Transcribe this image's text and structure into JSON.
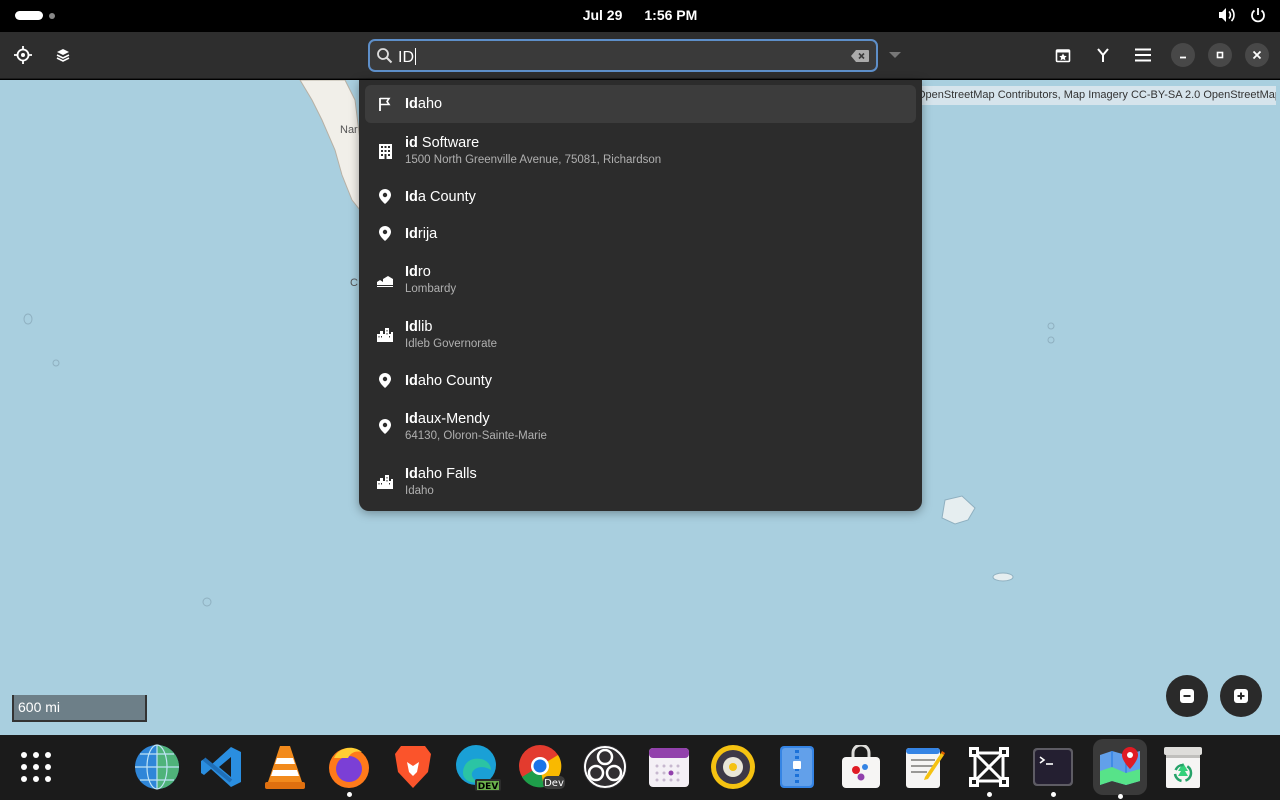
{
  "topbar": {
    "date": "Jul 29",
    "time": "1:56 PM"
  },
  "search": {
    "value": "ID"
  },
  "map": {
    "attribution": "OpenStreetMap Contributors, Map Imagery CC-BY-SA 2.0 OpenStreetMap",
    "scale_label": "600 mi",
    "place_fragments": [
      "Nar",
      "C"
    ]
  },
  "results": [
    {
      "bold": "Id",
      "rest": "aho",
      "sub": "",
      "icon": "flag-icon"
    },
    {
      "bold": "id",
      "rest": " Software",
      "sub": "1500 North Greenville Avenue, 75081, Richardson",
      "icon": "building-icon"
    },
    {
      "bold": "Id",
      "rest": "a County",
      "sub": "",
      "icon": "pin-icon"
    },
    {
      "bold": "Id",
      "rest": "rija",
      "sub": "",
      "icon": "pin-icon"
    },
    {
      "bold": "Id",
      "rest": "ro",
      "sub": "Lombardy",
      "icon": "town-icon"
    },
    {
      "bold": "Id",
      "rest": "lib",
      "sub": "Idleb Governorate",
      "icon": "city-icon"
    },
    {
      "bold": "Id",
      "rest": "aho County",
      "sub": "",
      "icon": "pin-icon"
    },
    {
      "bold": "Id",
      "rest": "aux-Mendy",
      "sub": "64130, Oloron-Sainte-Marie",
      "icon": "pin-icon"
    },
    {
      "bold": "Id",
      "rest": "aho Falls",
      "sub": "Idaho",
      "icon": "city-icon"
    }
  ],
  "dock": {
    "apps": [
      "app-grid",
      "globe",
      "vscode",
      "vlc",
      "firefox",
      "brave",
      "edge-dev",
      "chrome-dev",
      "obs",
      "calendar",
      "rhythmbox",
      "file-roller",
      "software",
      "text-editor",
      "boxes",
      "terminal",
      "maps",
      "trash"
    ]
  },
  "colors": {
    "map_water": "#a9cfdf",
    "accent": "#5e8fc9",
    "headerbar": "#2e2e2e",
    "popover": "#2c2c2c"
  }
}
